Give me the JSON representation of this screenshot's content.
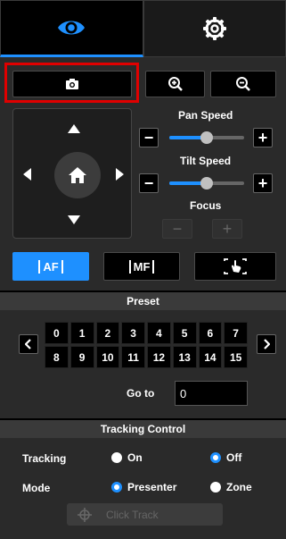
{
  "tabs": [
    {
      "icon": "eye-icon",
      "active": true
    },
    {
      "icon": "gear-icon",
      "active": false
    }
  ],
  "accent": "#1e90ff",
  "highlight": "#e00000",
  "sliders": {
    "pan": {
      "label": "Pan Speed",
      "value": 0.5
    },
    "tilt": {
      "label": "Tilt Speed",
      "value": 0.5
    }
  },
  "focus": {
    "label": "Focus",
    "minus": "−",
    "plus": "+"
  },
  "focus_modes": [
    {
      "label": "AF",
      "active": true
    },
    {
      "label": "MF",
      "active": false
    },
    {
      "label": "touch-focus",
      "active": false
    }
  ],
  "preset": {
    "title": "Preset",
    "numbers": [
      "0",
      "1",
      "2",
      "3",
      "4",
      "5",
      "6",
      "7",
      "8",
      "9",
      "10",
      "11",
      "12",
      "13",
      "14",
      "15"
    ],
    "goto_label": "Go to",
    "goto_value": "0"
  },
  "tracking": {
    "title": "Tracking Control",
    "tracking_label": "Tracking",
    "on_label": "On",
    "off_label": "Off",
    "tracking_value": "Off",
    "mode_label": "Mode",
    "presenter_label": "Presenter",
    "zone_label": "Zone",
    "mode_value": "Presenter",
    "click_track_label": "Click Track"
  }
}
